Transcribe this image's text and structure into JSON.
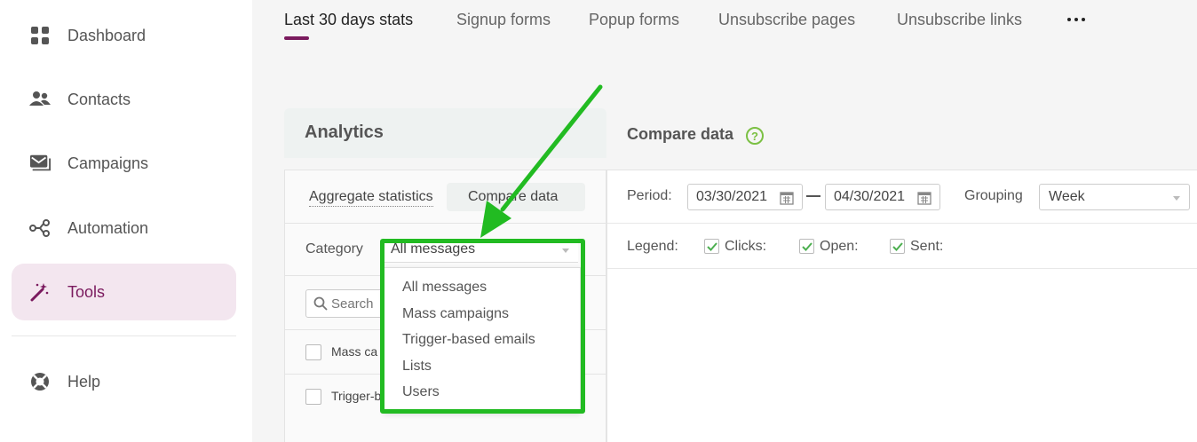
{
  "sidebar": {
    "items": [
      {
        "label": "Dashboard",
        "icon": "grid-icon"
      },
      {
        "label": "Contacts",
        "icon": "people-icon"
      },
      {
        "label": "Campaigns",
        "icon": "envelope-icon"
      },
      {
        "label": "Automation",
        "icon": "share-nodes-icon"
      },
      {
        "label": "Tools",
        "icon": "magic-wand-icon",
        "active": true
      },
      {
        "label": "Help",
        "icon": "lifebuoy-icon"
      }
    ]
  },
  "tabs": [
    {
      "label": "Last 30 days stats",
      "active": true
    },
    {
      "label": "Signup forms"
    },
    {
      "label": "Popup forms"
    },
    {
      "label": "Unsubscribe pages"
    },
    {
      "label": "Unsubscribe links"
    }
  ],
  "analytics": {
    "title": "Analytics",
    "subtabs": [
      "Aggregate statistics",
      "Compare data"
    ],
    "category_label": "Category",
    "category_value": "All messages",
    "search_placeholder": "Search",
    "list": [
      "Mass ca",
      "Trigger-b"
    ]
  },
  "dropdown": {
    "options": [
      "All messages",
      "Mass campaigns",
      "Trigger-based emails",
      "Lists",
      "Users"
    ]
  },
  "compare": {
    "title": "Compare data",
    "help": "?",
    "period_label": "Period:",
    "date_from": "03/30/2021",
    "date_to": "04/30/2021",
    "grouping_label": "Grouping",
    "grouping_value": "Week",
    "legend_label": "Legend:",
    "legend": [
      "Clicks:",
      "Open:",
      "Sent:"
    ]
  },
  "colors": {
    "accent": "#7a1a5e",
    "highlight": "#22bb22",
    "check": "#4caf50"
  }
}
